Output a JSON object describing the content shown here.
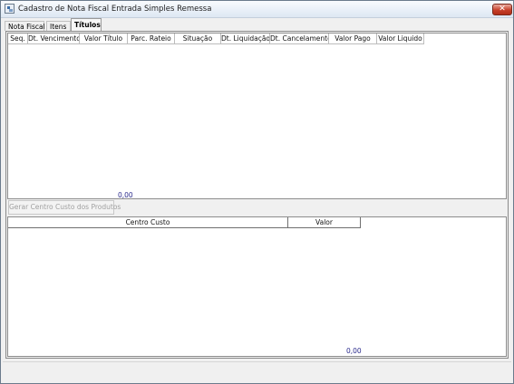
{
  "window": {
    "title": "Cadastro de Nota Fiscal Entrada Simples Remessa",
    "close_glyph": "✕"
  },
  "tabs": [
    {
      "label": "Nota Fiscal"
    },
    {
      "label": "Itens"
    },
    {
      "label": "Títulos",
      "active": true
    }
  ],
  "titulos_grid": {
    "columns": [
      "Seq.",
      "Dt. Vencimento",
      "Valor Título",
      "Parc. Rateio",
      "Situação",
      "Dt. Liquidação",
      "Dt. Cancelamento",
      "Valor Pago",
      "Valor Liquido"
    ],
    "total": "0,00"
  },
  "gerar_button": {
    "label": "Gerar Centro Custo dos Produtos",
    "enabled": false
  },
  "centro_grid": {
    "columns": [
      "Centro Custo",
      "Valor"
    ],
    "total": "0,00"
  }
}
